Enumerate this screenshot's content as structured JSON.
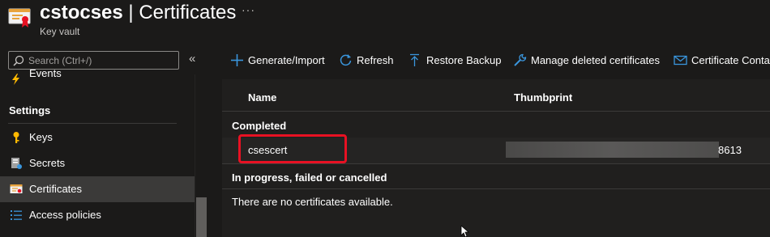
{
  "header": {
    "resource_name": "cstocses",
    "separator": " | ",
    "blade_title": "Certificates",
    "subtitle": "Key vault",
    "more_label": "···"
  },
  "sidebar": {
    "search_placeholder": "Search (Ctrl+/)",
    "collapse_label": "«",
    "items": [
      {
        "label": "Events",
        "icon": "lightning-icon"
      },
      {
        "label": "Keys",
        "icon": "key-icon"
      },
      {
        "label": "Secrets",
        "icon": "secret-doc-icon"
      },
      {
        "label": "Certificates",
        "icon": "certificate-icon",
        "selected": true
      },
      {
        "label": "Access policies",
        "icon": "policy-list-icon"
      }
    ],
    "section_title": "Settings"
  },
  "toolbar": {
    "generate": "Generate/Import",
    "refresh": "Refresh",
    "restore": "Restore Backup",
    "manage_deleted": "Manage deleted certificates",
    "contacts": "Certificate Conta"
  },
  "grid": {
    "col_name": "Name",
    "col_thumbprint": "Thumbprint",
    "group_completed": "Completed",
    "rows": [
      {
        "name": "csescert",
        "thumbprint_tail": "8613"
      }
    ],
    "group_in_progress": "In progress, failed or cancelled",
    "empty_message": "There are no certificates available."
  },
  "colors": {
    "background": "#1b1a19",
    "accent": "#3a96dd",
    "highlight": "#e81123"
  }
}
